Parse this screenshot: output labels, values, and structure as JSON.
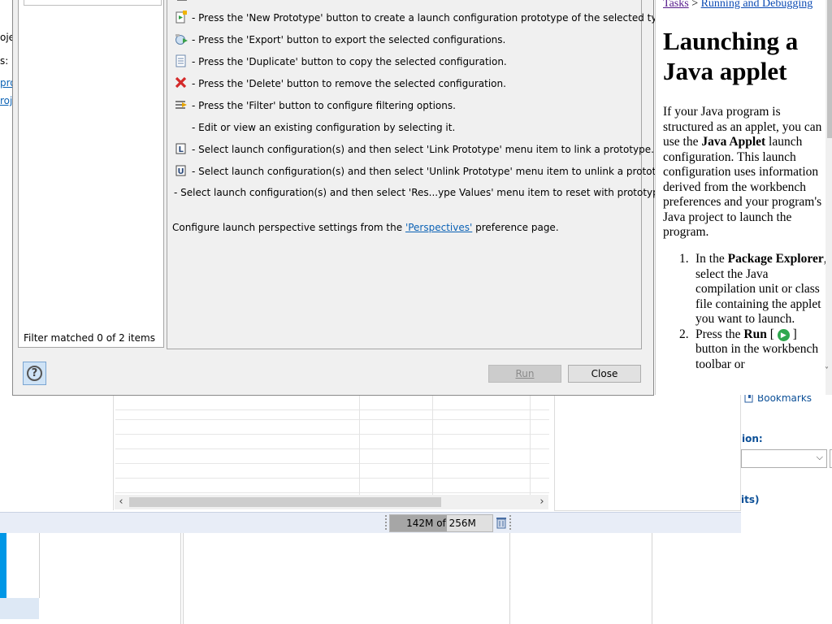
{
  "background": {
    "left_fragments": [
      "oje",
      "s:",
      "proj",
      "roje"
    ],
    "bookmarks_label": "Bookmarks",
    "ion_label": "ion:",
    "its_label": "its)",
    "heap": {
      "text": "142M of 256M",
      "used_fraction": 0.555
    }
  },
  "dialog": {
    "filter_status": "Filter matched 0 of 2 items",
    "help_rows": [
      {
        "icon": "new-prototype-icon",
        "text": "- Press the 'New Prototype' button to create a launch configuration prototype of the selected type."
      },
      {
        "icon": "export-icon",
        "text": "- Press the 'Export' button to export the selected configurations."
      },
      {
        "icon": "duplicate-icon",
        "text": "- Press the 'Duplicate' button to copy the selected configuration."
      },
      {
        "icon": "delete-icon",
        "text": "- Press the 'Delete' button to remove the selected configuration."
      },
      {
        "icon": "filter-icon",
        "text": "- Press the 'Filter' button to configure filtering options."
      },
      {
        "icon": "",
        "text": "- Edit or view an existing configuration by selecting it."
      },
      {
        "icon": "link-prototype-icon",
        "text": "- Select launch configuration(s) and then select 'Link Prototype' menu item to link a prototype."
      },
      {
        "icon": "unlink-prototype-icon",
        "text": "- Select launch configuration(s) and then select 'Unlink Prototype' menu item to unlink a prototype."
      },
      {
        "icon": "",
        "text": "- Select launch configuration(s) and then select 'Res...ype Values' menu item to reset with prototype values."
      }
    ],
    "perspectives_prefix": "Configure launch perspective settings from the ",
    "perspectives_link": "'Perspectives'",
    "perspectives_suffix": " preference page.",
    "run_label": "Run",
    "close_label": "Close"
  },
  "help_window": {
    "breadcrumb_tasks": "Tasks",
    "breadcrumb_sep": " > ",
    "breadcrumb_running": "Running and Debugging",
    "title": "Launching a Java applet",
    "intro_1": "If your Java program is structured as an applet, you can use the ",
    "intro_bold": "Java Applet",
    "intro_2": " launch configuration.  This launch configuration uses information derived from the workbench preferences and your program's Java project to launch the program.",
    "step1_num": "1.",
    "step1_a": "In the ",
    "step1_bold": "Package Explorer",
    "step1_b": ", select the Java compilation unit or class file containing the applet you want to launch.",
    "step2_num": "2.",
    "step2_a": "Press the ",
    "step2_bold": "Run",
    "step2_b": " [ ",
    "step2_c": " ] button in the workbench toolbar or"
  }
}
